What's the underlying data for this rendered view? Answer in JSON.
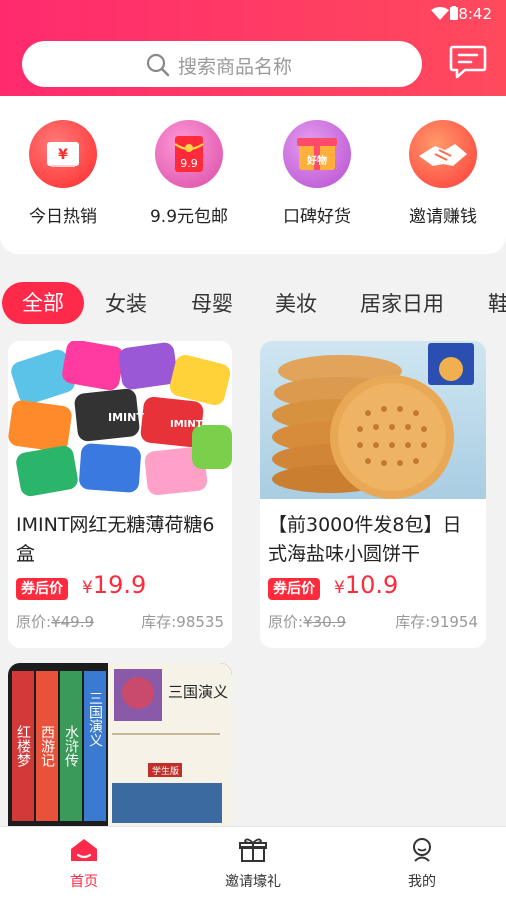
{
  "status_bar": {
    "time": "8:42"
  },
  "search": {
    "placeholder": "搜索商品名称",
    "icon": "search-icon"
  },
  "header": {
    "message_icon": "message-icon"
  },
  "categories": [
    {
      "label": "今日热销",
      "icon": "ticket-icon",
      "color": "#ff3b3b"
    },
    {
      "label": "9.9元包邮",
      "icon": "red-envelope-icon",
      "color": "#e84aa6"
    },
    {
      "label": "口碑好货",
      "icon": "gift-box-icon",
      "color": "#c65bd6"
    },
    {
      "label": "邀请赚钱",
      "icon": "handshake-icon",
      "color": "#ff5a3a"
    }
  ],
  "tabs": [
    "全部",
    "女装",
    "母婴",
    "美妆",
    "居家日用",
    "鞋"
  ],
  "active_tab": "全部",
  "products": [
    {
      "title": "IMINT网红无糖薄荷糖6盒",
      "tag": "券后价",
      "currency": "¥",
      "price": "19.9",
      "original_label": "原价:",
      "original_price": "¥49.9",
      "stock": "库存:98535",
      "image": "mint-tins-image",
      "image_text": "IMINT"
    },
    {
      "title": "【前3000件发8包】日式海盐味小圆饼干",
      "tag": "券后价",
      "currency": "¥",
      "price": "10.9",
      "original_label": "原价:",
      "original_price": "¥30.9",
      "stock": "库存:91954",
      "image": "round-biscuits-image"
    },
    {
      "title": "",
      "image": "classic-novels-books-image",
      "book_spines": [
        "红楼梦",
        "西游记",
        "水浒传",
        "三国演义"
      ],
      "cover_title": "三国演义",
      "cover_badge": "学生版"
    }
  ],
  "bottom_nav": [
    {
      "label": "首页",
      "icon": "home-icon",
      "active": true
    },
    {
      "label": "邀请壕礼",
      "icon": "gift-icon",
      "active": false
    },
    {
      "label": "我的",
      "icon": "user-icon",
      "active": false
    }
  ],
  "colors": {
    "primary": "#ff2a4a",
    "header_gradient_start": "#ff2a6e",
    "header_gradient_end": "#ff4a5c"
  }
}
